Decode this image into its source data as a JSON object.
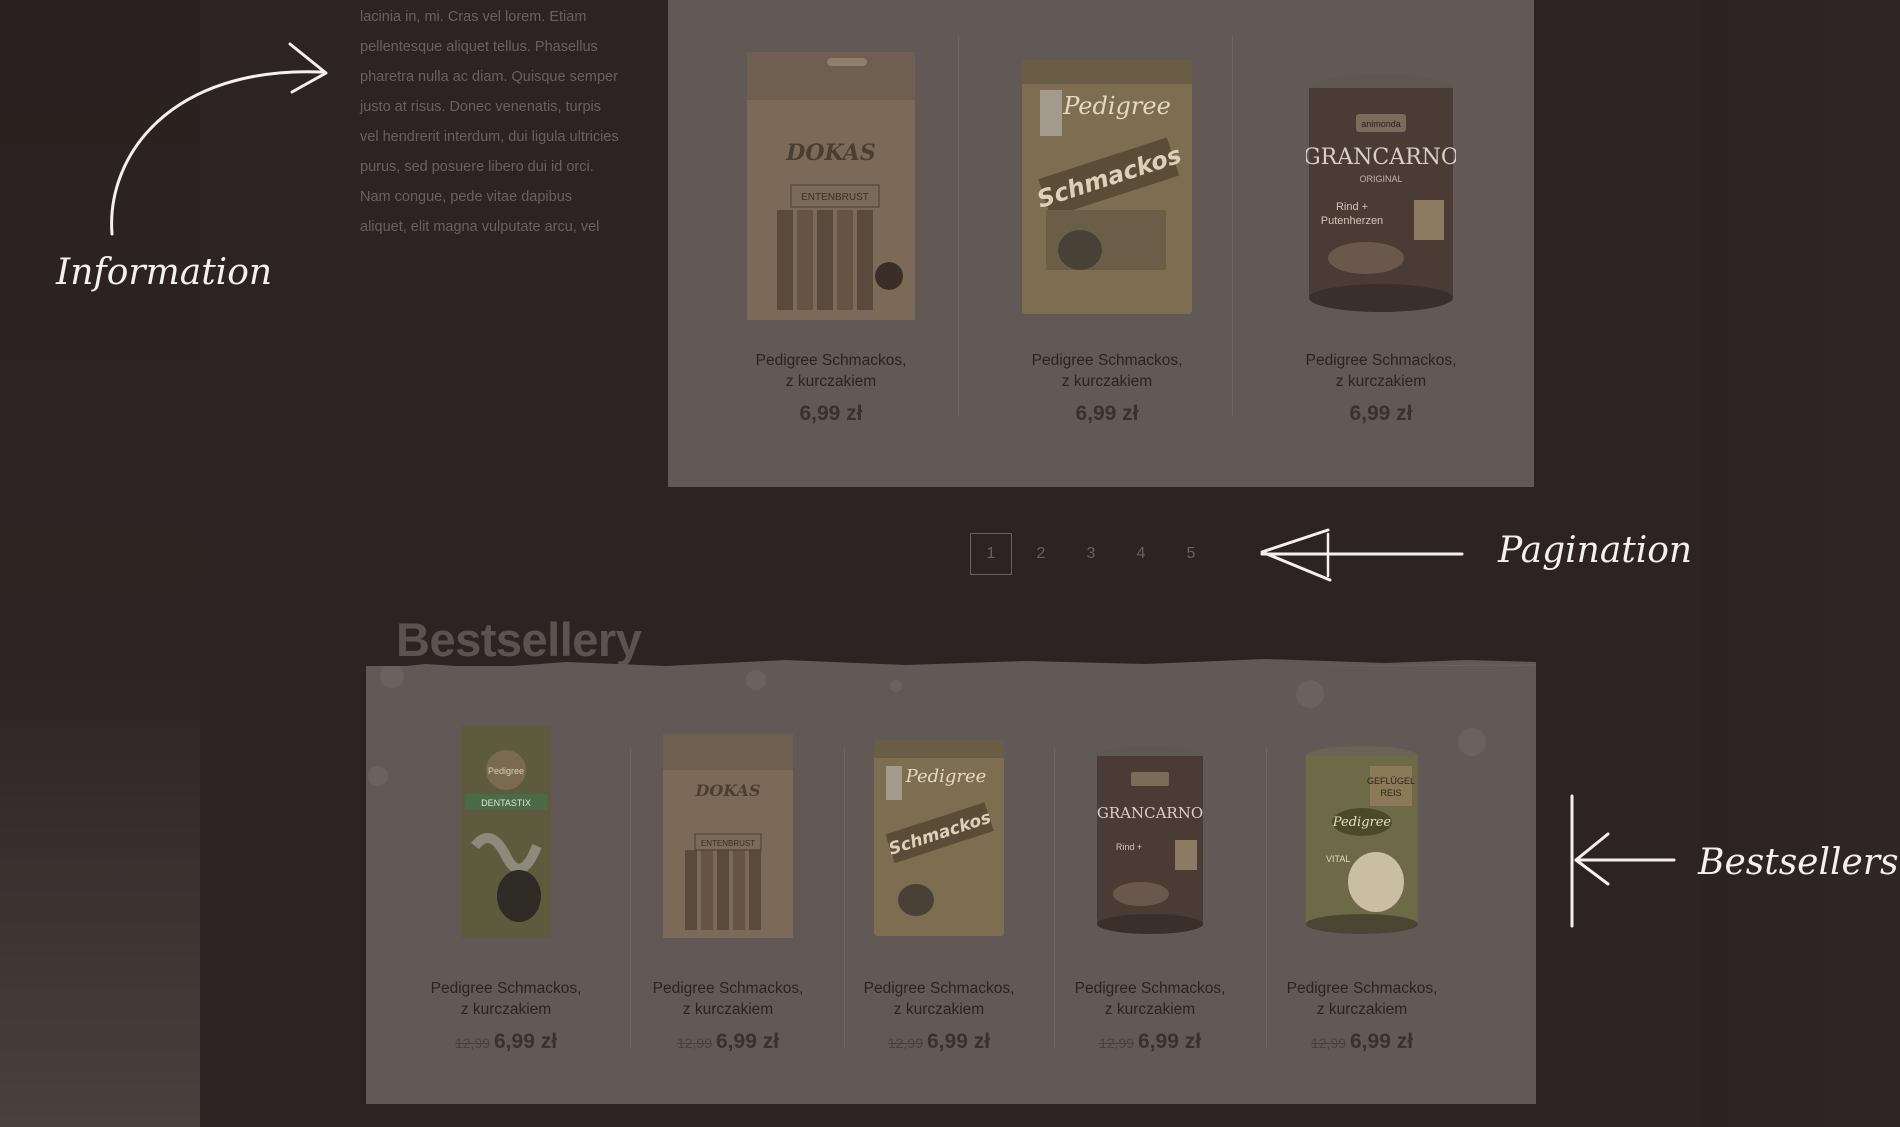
{
  "info": {
    "text": "lacinia in, mi. Cras vel lorem. Etiam pellentesque aliquet tellus. Phasellus pharetra nulla ac diam. Quisque semper justo at risus. Donec venenatis, turpis vel hendrerit interdum, dui ligula ultricies purus, sed posuere libero dui id orci. Nam congue, pede vitae dapibus aliquet, elit magna vulputate arcu, vel"
  },
  "top_products": [
    {
      "name_line1": "Pedigree Schmackos,",
      "name_line2": "z kurczakiem",
      "price": "6,99 zł",
      "image": "dokas-entenbrust-pack"
    },
    {
      "name_line1": "Pedigree Schmackos,",
      "name_line2": "z kurczakiem",
      "price": "6,99 zł",
      "image": "pedigree-schmackos-pack"
    },
    {
      "name_line1": "Pedigree Schmackos,",
      "name_line2": "z kurczakiem",
      "price": "6,99 zł",
      "image": "grancarno-can"
    }
  ],
  "pagination": {
    "pages": [
      "1",
      "2",
      "3",
      "4",
      "5"
    ],
    "active": "1"
  },
  "bestsellers": {
    "title": "Bestsellery",
    "products": [
      {
        "name_line1": "Pedigree Schmackos,",
        "name_line2": "z kurczakiem",
        "old_price": "12,99",
        "price": "6,99 zł",
        "image": "pedigree-dentastix-pack"
      },
      {
        "name_line1": "Pedigree Schmackos,",
        "name_line2": "z kurczakiem",
        "old_price": "12,99",
        "price": "6,99 zł",
        "image": "dokas-entenbrust-pack"
      },
      {
        "name_line1": "Pedigree Schmackos,",
        "name_line2": "z kurczakiem",
        "old_price": "12,99",
        "price": "6,99 zł",
        "image": "pedigree-schmackos-pack"
      },
      {
        "name_line1": "Pedigree Schmackos,",
        "name_line2": "z kurczakiem",
        "old_price": "12,99",
        "price": "6,99 zł",
        "image": "grancarno-can"
      },
      {
        "name_line1": "Pedigree Schmackos,",
        "name_line2": "z kurczakiem",
        "old_price": "12,99",
        "price": "6,99 zł",
        "image": "pedigree-puppy-can"
      }
    ]
  },
  "annotations": {
    "information": "Information",
    "pagination": "Pagination",
    "bestsellers": "Bestsellers"
  },
  "colors": {
    "page_bg": "#2c2221",
    "panel_bg": "#625957",
    "text_muted": "#6b605d",
    "annotation": "#f4f0ee"
  }
}
